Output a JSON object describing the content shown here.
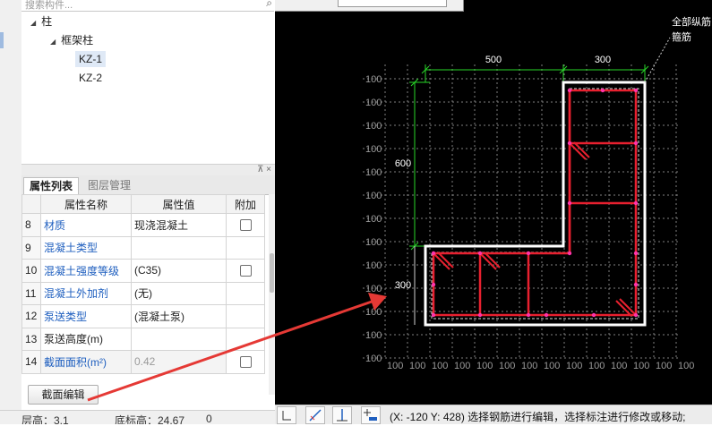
{
  "tree": {
    "search_placeholder": "搜索构件...",
    "nodes": [
      {
        "label": "柱",
        "toggle": "◢"
      },
      {
        "label": "框架柱",
        "toggle": "◢"
      },
      {
        "label": "KZ-1"
      },
      {
        "label": "KZ-2"
      }
    ]
  },
  "panel": {
    "pin_label": "⊼ ×",
    "tabs": [
      {
        "label": "属性列表"
      },
      {
        "label": "图层管理"
      }
    ],
    "columns": [
      "属性名称",
      "属性值",
      "附加"
    ],
    "rows": [
      {
        "num": "8",
        "name": "材质",
        "value": "现浇混凝土",
        "has_checkbox": true
      },
      {
        "num": "9",
        "name": "混凝土类型",
        "value": "",
        "has_checkbox": false
      },
      {
        "num": "10",
        "name": "混凝土强度等级",
        "value": "(C35)",
        "has_checkbox": true
      },
      {
        "num": "11",
        "name": "混凝土外加剂",
        "value": "(无)",
        "has_checkbox": false
      },
      {
        "num": "12",
        "name": "泵送类型",
        "value": "(混凝土泵)",
        "has_checkbox": false
      },
      {
        "num": "13",
        "name": "泵送高度(m)",
        "value": "",
        "has_checkbox": false
      },
      {
        "num": "14",
        "name": "截面面积(m²)",
        "value": "0.42",
        "has_checkbox": true
      }
    ],
    "section_edit_button": "截面编辑"
  },
  "status_left": {
    "floor_height": "层高：3.1",
    "bottom_elev": "底标高：24.67",
    "zero": "0"
  },
  "drawing": {
    "dims": {
      "top_left": "500",
      "top_right": "300",
      "left_upper": "600",
      "left_lower": "300"
    },
    "grid_label": "100",
    "annotation_line1": "全部纵筋",
    "annotation_line2": "箍筋",
    "colors": {
      "background": "#000000",
      "outline": "#ffffff",
      "rebar": "#e8202f",
      "dimension": "#29d629",
      "grid": "#808080",
      "arrow": "#e53935"
    }
  },
  "status_right": {
    "message": "(X: -120 Y: 428)  选择钢筋进行编辑，选择标注进行修改或移动;"
  }
}
